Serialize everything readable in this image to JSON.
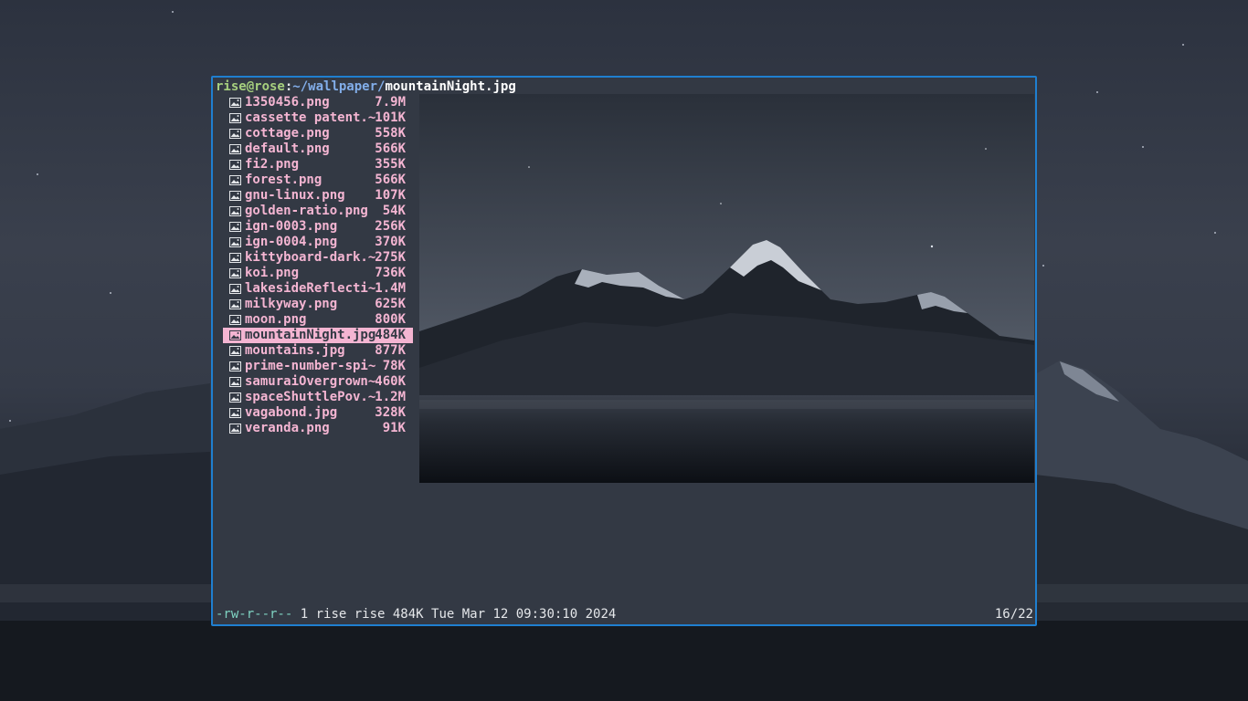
{
  "titlebar": {
    "user_host": "rise@rose",
    "separator": ":",
    "path": "~/wallpaper/",
    "current_file": "mountainNight.jpg"
  },
  "files": [
    {
      "name": "1350456.png",
      "size": "7.9M",
      "icon": "image-file-icon"
    },
    {
      "name": "cassette patent.~",
      "size": "101K",
      "icon": "image-file-icon"
    },
    {
      "name": "cottage.png",
      "size": "558K",
      "icon": "image-file-icon"
    },
    {
      "name": "default.png",
      "size": "566K",
      "icon": "image-file-icon"
    },
    {
      "name": "fi2.png",
      "size": "355K",
      "icon": "image-file-icon"
    },
    {
      "name": "forest.png",
      "size": "566K",
      "icon": "image-file-icon"
    },
    {
      "name": "gnu-linux.png",
      "size": "107K",
      "icon": "image-file-icon"
    },
    {
      "name": "golden-ratio.png",
      "size": "54K",
      "icon": "image-file-icon"
    },
    {
      "name": "ign-0003.png",
      "size": "256K",
      "icon": "image-file-icon"
    },
    {
      "name": "ign-0004.png",
      "size": "370K",
      "icon": "image-file-icon"
    },
    {
      "name": "kittyboard-dark.~",
      "size": "275K",
      "icon": "image-file-icon"
    },
    {
      "name": "koi.png",
      "size": "736K",
      "icon": "image-file-icon"
    },
    {
      "name": "lakesideReflecti~",
      "size": "1.4M",
      "icon": "image-file-icon"
    },
    {
      "name": "milkyway.png",
      "size": "625K",
      "icon": "image-file-icon"
    },
    {
      "name": "moon.png",
      "size": "800K",
      "icon": "image-file-icon"
    },
    {
      "name": "mountainNight.jpg",
      "size": "484K",
      "icon": "image-file-icon",
      "selected": true
    },
    {
      "name": "mountains.jpg",
      "size": "877K",
      "icon": "image-file-icon"
    },
    {
      "name": "prime-number-spi~",
      "size": "78K",
      "icon": "image-file-icon"
    },
    {
      "name": "samuraiOvergrown~",
      "size": "460K",
      "icon": "image-file-icon"
    },
    {
      "name": "spaceShuttlePov.~",
      "size": "1.2M",
      "icon": "image-file-icon"
    },
    {
      "name": "vagabond.jpg",
      "size": "328K",
      "icon": "image-file-icon"
    },
    {
      "name": "veranda.png",
      "size": "91K",
      "icon": "image-file-icon"
    }
  ],
  "statusbar": {
    "permissions": "-rw-r--r--",
    "details": " 1 rise rise 484K Tue Mar 12 09:30:10 2024",
    "position": "16/22"
  },
  "colors": {
    "border": "#1f7fd0",
    "background": "#333944",
    "file_text": "#f4b5d2",
    "user_host": "#a6cf7e",
    "path": "#82aeea",
    "permissions": "#7fd3c2"
  }
}
